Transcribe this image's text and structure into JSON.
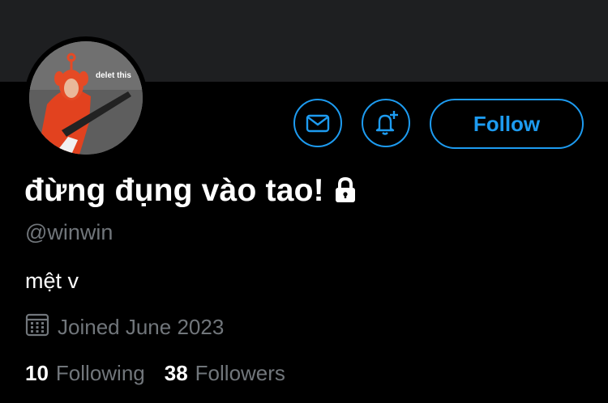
{
  "profile": {
    "display_name": "đừng đụng vào tao!",
    "handle": "@winwin",
    "bio": "mệt v",
    "joined": "Joined June 2023",
    "protected_icon": "lock-icon",
    "avatar_caption": "delet this"
  },
  "actions": {
    "message_icon": "envelope-icon",
    "notify_icon": "bell-plus-icon",
    "follow_label": "Follow"
  },
  "stats": {
    "following_count": "10",
    "following_label": "Following",
    "followers_count": "38",
    "followers_label": "Followers"
  },
  "colors": {
    "accent": "#1d9bf0",
    "background": "#000000",
    "banner": "#1e1f21",
    "muted_text": "#71767b"
  }
}
